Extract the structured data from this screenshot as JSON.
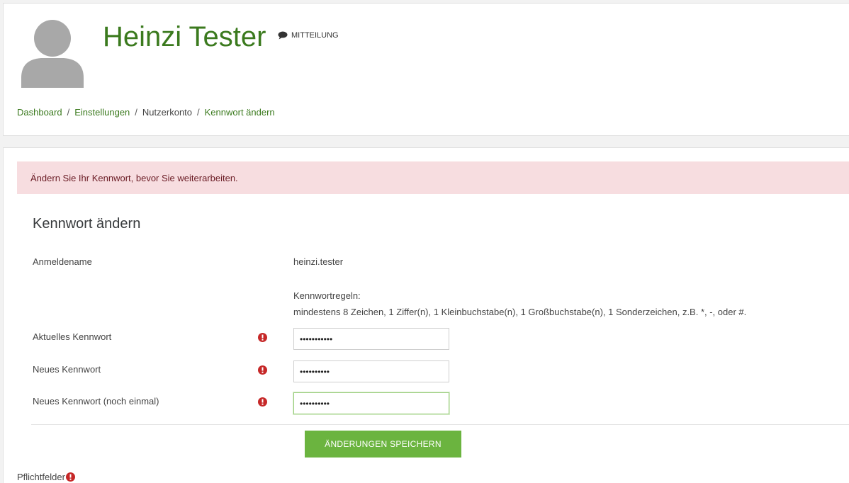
{
  "header": {
    "user_name": "Heinzi Tester",
    "message_label": "MITTEILUNG",
    "breadcrumb": [
      {
        "label": "Dashboard",
        "link": true
      },
      {
        "label": "Einstellungen",
        "link": true
      },
      {
        "label": "Nutzerkonto",
        "link": false
      },
      {
        "label": "Kennwort ändern",
        "link": true
      }
    ],
    "separator": "/"
  },
  "alert": {
    "text": "Ändern Sie Ihr Kennwort, bevor Sie weiterarbeiten."
  },
  "form": {
    "title": "Kennwort ändern",
    "username_label": "Anmeldename",
    "username_value": "heinzi.tester",
    "rules_title": "Kennwortregeln:",
    "rules_text": "mindestens 8 Zeichen, 1 Ziffer(n), 1 Kleinbuchstabe(n), 1 Großbuchstabe(n), 1 Sonderzeichen, z.B. *, -, oder #.",
    "current_password_label": "Aktuelles Kennwort",
    "current_password_value": "•••••••••••",
    "new_password_label": "Neues Kennwort",
    "new_password_value": "••••••••••",
    "new_password_again_label": "Neues Kennwort (noch einmal)",
    "new_password_again_value": "••••••••••",
    "save_label": "ÄNDERUNGEN SPEICHERN",
    "required_note": "Pflichtfelder"
  },
  "colors": {
    "accent": "#3b7a1e",
    "button": "#6bb43f",
    "alert_bg": "#f7dde0",
    "required_icon": "#c62828"
  },
  "icons": {
    "avatar": "user-avatar-icon",
    "message": "speech-bubble-icon",
    "required": "exclamation-circle-icon"
  }
}
